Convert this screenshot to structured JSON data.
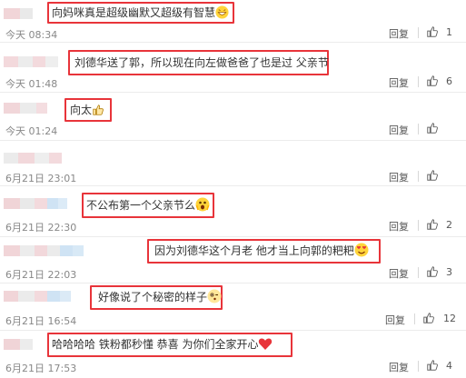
{
  "comments": [
    {
      "text": "向妈咪真是超级幽默又超级有智慧",
      "emoji": "laugh-emoji",
      "time": "今天 08:34",
      "reply": "回复",
      "likes": "1"
    },
    {
      "text": "刘德华送了郭，所以现在向左做爸爸了也是过 父亲节",
      "emoji": "",
      "time": "今天 01:48",
      "reply": "回复",
      "likes": "6"
    },
    {
      "text": "向太",
      "emoji": "thumbs-up-emoji",
      "time": "今天 01:24",
      "reply": "回复",
      "likes": ""
    },
    {
      "text": "",
      "emoji": "",
      "time": "6月21日 23:01",
      "reply": "回复",
      "likes": ""
    },
    {
      "text": "不公布第一个父亲节么",
      "emoji": "shocked-emoji",
      "time": "6月21日 22:30",
      "reply": "回复",
      "likes": "2"
    },
    {
      "text": "因为刘德华这个月老  他才当上向郭的粑粑",
      "emoji": "heart-eyes-emoji",
      "time": "6月21日 22:03",
      "reply": "回复",
      "likes": "3"
    },
    {
      "text": "好像说了个秘密的样子",
      "emoji": "wink-emoji",
      "time": "6月21日 16:54",
      "reply": "回复",
      "likes": "12"
    },
    {
      "text": "哈哈哈哈  铁粉都秒懂  恭喜  为你们全家开心",
      "emoji": "heart-emoji",
      "time": "6月21日 17:53",
      "reply": "回复",
      "likes": "4"
    }
  ],
  "colors": {
    "highlight": "#e8343a",
    "mosaic_pink": "#f3d9dc",
    "mosaic_gray": "#e4e4e4",
    "mosaic_blue": "#cfe3f4",
    "timestamp": "#888888"
  }
}
